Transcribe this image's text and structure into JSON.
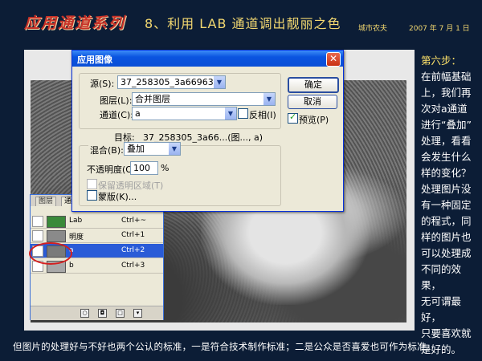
{
  "header": {
    "series_title": "应用通道系列",
    "lesson_title": "8、利用 LAB 通道调出靓丽之色",
    "author": "城市农夫",
    "date": "2007 年 7 月 1 日"
  },
  "right_text": {
    "step": "第六步：",
    "lines": [
      "在前幅基础",
      "上，我们再",
      "次对a通道",
      "进行“叠加”",
      "处理，看看",
      "会发生什么",
      "样的变化？",
      "处理图片没",
      "有一种固定",
      "的程式，同",
      "样的图片也",
      "可以处理成",
      "不同的效果，",
      "无可谓最好，",
      "只要喜欢就",
      "是好的。"
    ]
  },
  "bottom_text": "但图片的处理好与不好也两个公认的标准，一是符合技术制作标准；二是公众是否喜爱也可作为标准。",
  "dialog": {
    "title": "应用图像",
    "close": "✕",
    "source_label": "源(S):",
    "source_value": "37_258305_3a6696394...",
    "layer_label": "图层(L):",
    "layer_value": "合并图层",
    "channel_label": "通道(C):",
    "channel_value": "a",
    "invert_label": "反相(I)",
    "target_label": "目标:",
    "target_value": "37_258305_3a66...(图..., a)",
    "blend_label": "混合(B):",
    "blend_value": "叠加",
    "opacity_label": "不透明度(O):",
    "opacity_value": "100",
    "opacity_unit": "%",
    "preserve_label": "保留透明区域(T)",
    "mask_label": "蒙版(K)...",
    "ok": "确定",
    "cancel": "取消",
    "preview_label": "预览(P)"
  },
  "layers_panel": {
    "tabs": [
      "图层",
      "通道"
    ],
    "rows": [
      {
        "name": "Lab",
        "shortcut": "Ctrl+~",
        "color": "#3a8a3a"
      },
      {
        "name": "明度",
        "shortcut": "Ctrl+1",
        "color": "#8a8a8a"
      },
      {
        "name": "a",
        "shortcut": "Ctrl+2",
        "color": "#7a7a7a"
      },
      {
        "name": "b",
        "shortcut": "Ctrl+3",
        "color": "#a8a8a8"
      }
    ]
  }
}
